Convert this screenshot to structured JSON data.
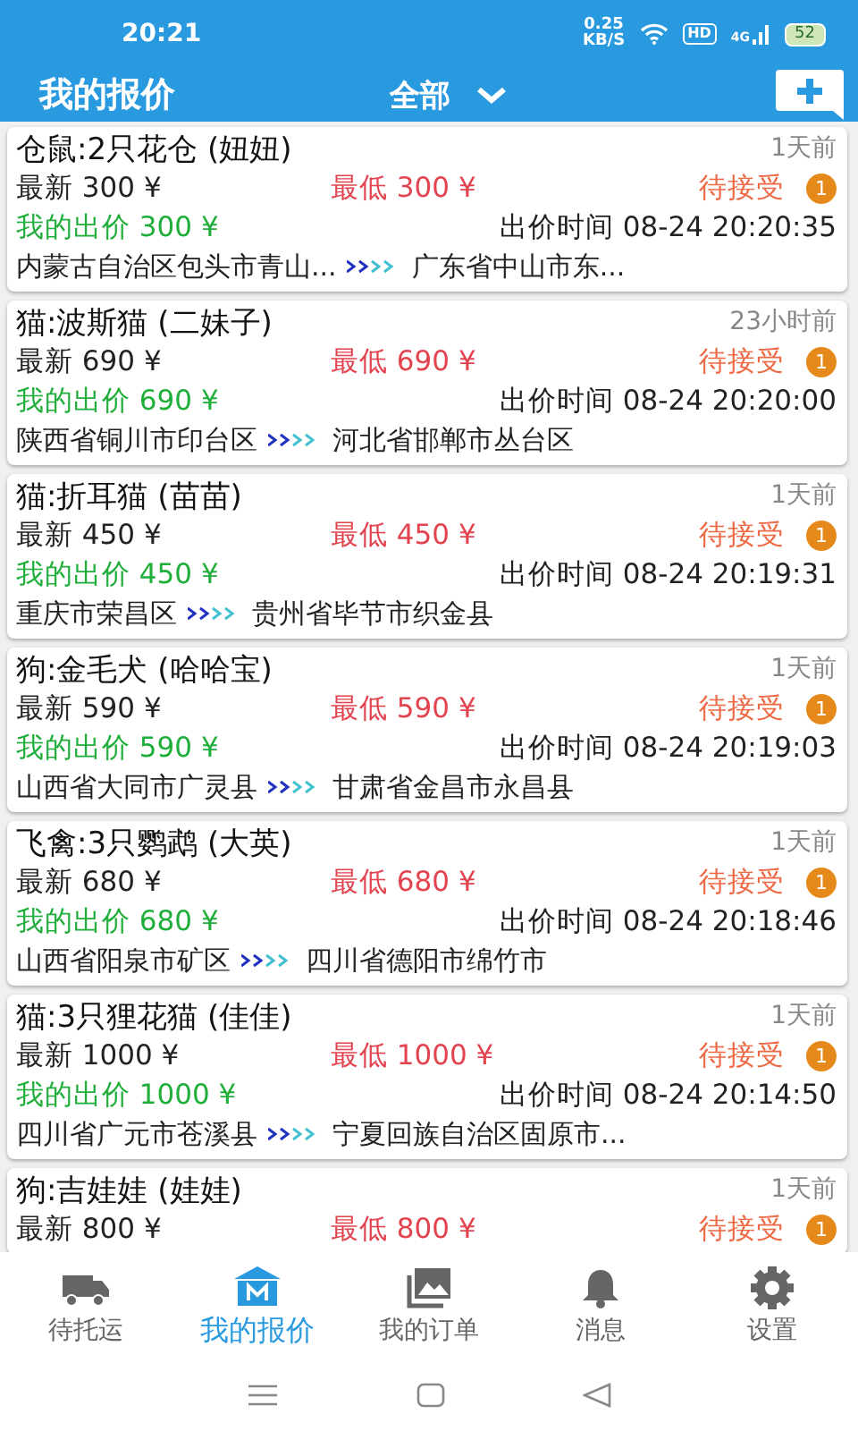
{
  "status_bar": {
    "time": "20:21",
    "speed": "0.25",
    "speed_unit": "KB/S",
    "hd": "HD",
    "network": "4G",
    "battery": "52"
  },
  "header": {
    "title": "我的报价",
    "filter": "全部"
  },
  "offers": [
    {
      "title": "仓鼠:2只花仓 (妞妞)",
      "ago": "1天前",
      "latest": "最新 300 ¥",
      "lowest": "最低 300 ¥",
      "status": "待接受",
      "count": "1",
      "my_price": "我的出价 300 ¥",
      "time": "出价时间 08-24 20:20:35",
      "from": "内蒙古自治区包头市青山...",
      "to": "广东省中山市东..."
    },
    {
      "title": "猫:波斯猫 (二妹子)",
      "ago": "23小时前",
      "latest": "最新 690 ¥",
      "lowest": "最低 690 ¥",
      "status": "待接受",
      "count": "1",
      "my_price": "我的出价 690 ¥",
      "time": "出价时间 08-24 20:20:00",
      "from": "陕西省铜川市印台区",
      "to": "河北省邯郸市丛台区"
    },
    {
      "title": "猫:折耳猫 (苗苗)",
      "ago": "1天前",
      "latest": "最新 450 ¥",
      "lowest": "最低 450 ¥",
      "status": "待接受",
      "count": "1",
      "my_price": "我的出价 450 ¥",
      "time": "出价时间 08-24 20:19:31",
      "from": "重庆市荣昌区",
      "to": "贵州省毕节市织金县"
    },
    {
      "title": "狗:金毛犬 (哈哈宝)",
      "ago": "1天前",
      "latest": "最新 590 ¥",
      "lowest": "最低 590 ¥",
      "status": "待接受",
      "count": "1",
      "my_price": "我的出价 590 ¥",
      "time": "出价时间 08-24 20:19:03",
      "from": "山西省大同市广灵县",
      "to": "甘肃省金昌市永昌县"
    },
    {
      "title": "飞禽:3只鹦鹉 (大英)",
      "ago": "1天前",
      "latest": "最新 680 ¥",
      "lowest": "最低 680 ¥",
      "status": "待接受",
      "count": "1",
      "my_price": "我的出价 680 ¥",
      "time": "出价时间 08-24 20:18:46",
      "from": "山西省阳泉市矿区",
      "to": "四川省德阳市绵竹市"
    },
    {
      "title": "猫:3只狸花猫 (佳佳)",
      "ago": "1天前",
      "latest": "最新 1000 ¥",
      "lowest": "最低 1000 ¥",
      "status": "待接受",
      "count": "1",
      "my_price": "我的出价 1000 ¥",
      "time": "出价时间 08-24 20:14:50",
      "from": "四川省广元市苍溪县",
      "to": "宁夏回族自治区固原市..."
    },
    {
      "title": "狗:吉娃娃 (娃娃)",
      "ago": "1天前",
      "latest": "最新 800 ¥",
      "lowest": "最低 800 ¥",
      "status": "待接受",
      "count": "1"
    }
  ],
  "tabs": [
    {
      "label": "待托运",
      "kind": "truck",
      "selected": false
    },
    {
      "label": "我的报价",
      "kind": "home",
      "selected": true
    },
    {
      "label": "我的订单",
      "kind": "photos",
      "selected": false
    },
    {
      "label": "消息",
      "kind": "bell",
      "selected": false
    },
    {
      "label": "设置",
      "kind": "gear",
      "selected": false
    }
  ]
}
